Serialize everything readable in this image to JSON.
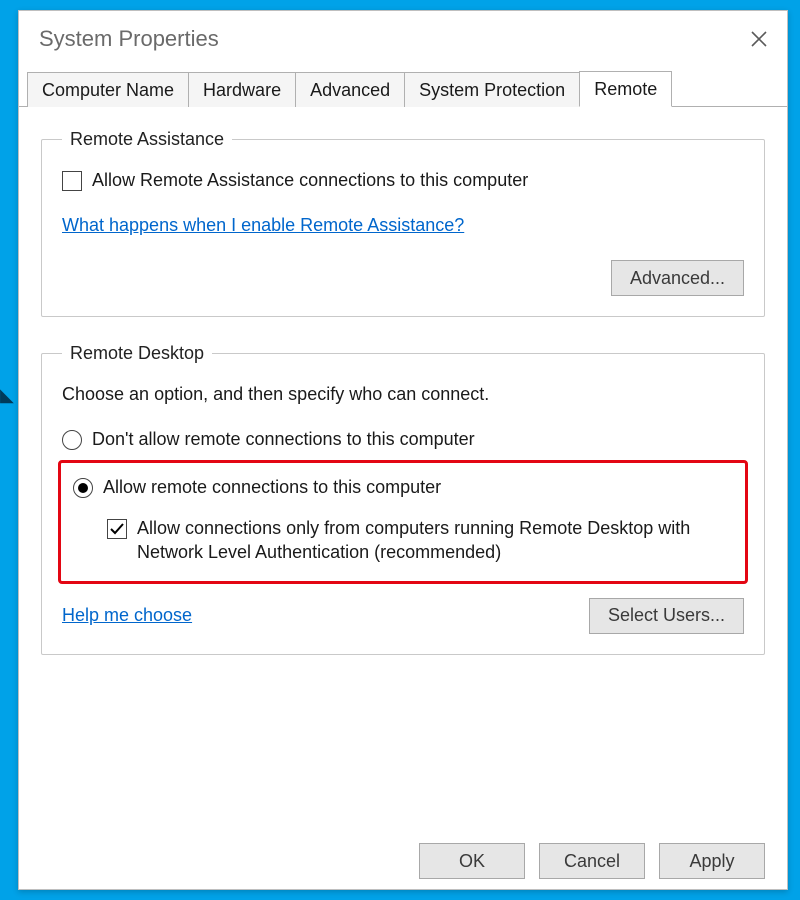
{
  "window": {
    "title": "System Properties"
  },
  "tabs": {
    "computer_name": "Computer Name",
    "hardware": "Hardware",
    "advanced": "Advanced",
    "system_protection": "System Protection",
    "remote": "Remote"
  },
  "remote_assistance": {
    "legend": "Remote Assistance",
    "allow_label": "Allow Remote Assistance connections to this computer",
    "allow_checked": false,
    "help_link": "What happens when I enable Remote Assistance?",
    "advanced_button": "Advanced..."
  },
  "remote_desktop": {
    "legend": "Remote Desktop",
    "intro": "Choose an option, and then specify who can connect.",
    "option_deny": "Don't allow remote connections to this computer",
    "option_allow": "Allow remote connections to this computer",
    "selected": "allow",
    "nla_label": "Allow connections only from computers running Remote Desktop with Network Level Authentication (recommended)",
    "nla_checked": true,
    "help_link": "Help me choose",
    "select_users_button": "Select Users..."
  },
  "footer": {
    "ok": "OK",
    "cancel": "Cancel",
    "apply": "Apply"
  }
}
